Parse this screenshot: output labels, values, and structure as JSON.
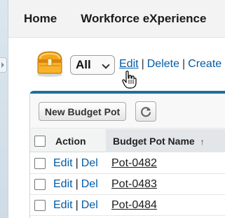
{
  "nav": {
    "items": [
      "Home",
      "Workforce eXperience"
    ]
  },
  "view": {
    "selected": "All",
    "links": {
      "edit": "Edit",
      "delete": "Delete",
      "create": "Create",
      "separator": "|"
    }
  },
  "toolbar": {
    "new_button_label": "New Budget Pot"
  },
  "table": {
    "headers": {
      "action": "Action",
      "name": "Budget Pot Name",
      "sort_indicator": "↑"
    },
    "rows": [
      {
        "edit": "Edit",
        "sep": "|",
        "del": "Del",
        "name": "Pot-0482"
      },
      {
        "edit": "Edit",
        "sep": "|",
        "del": "Del",
        "name": "Pot-0483"
      },
      {
        "edit": "Edit",
        "sep": "|",
        "del": "Del",
        "name": "Pot-0484"
      }
    ]
  },
  "icons": {
    "view_icon": "treasure-chest-icon",
    "refresh": "refresh-icon",
    "cursor": "hand-pointer-icon",
    "dropdown": "chevron-down-icon"
  },
  "colors": {
    "link": "#015ba7",
    "panel_accent": "#1d6ea0",
    "nav_background": "#f3f3f3"
  }
}
